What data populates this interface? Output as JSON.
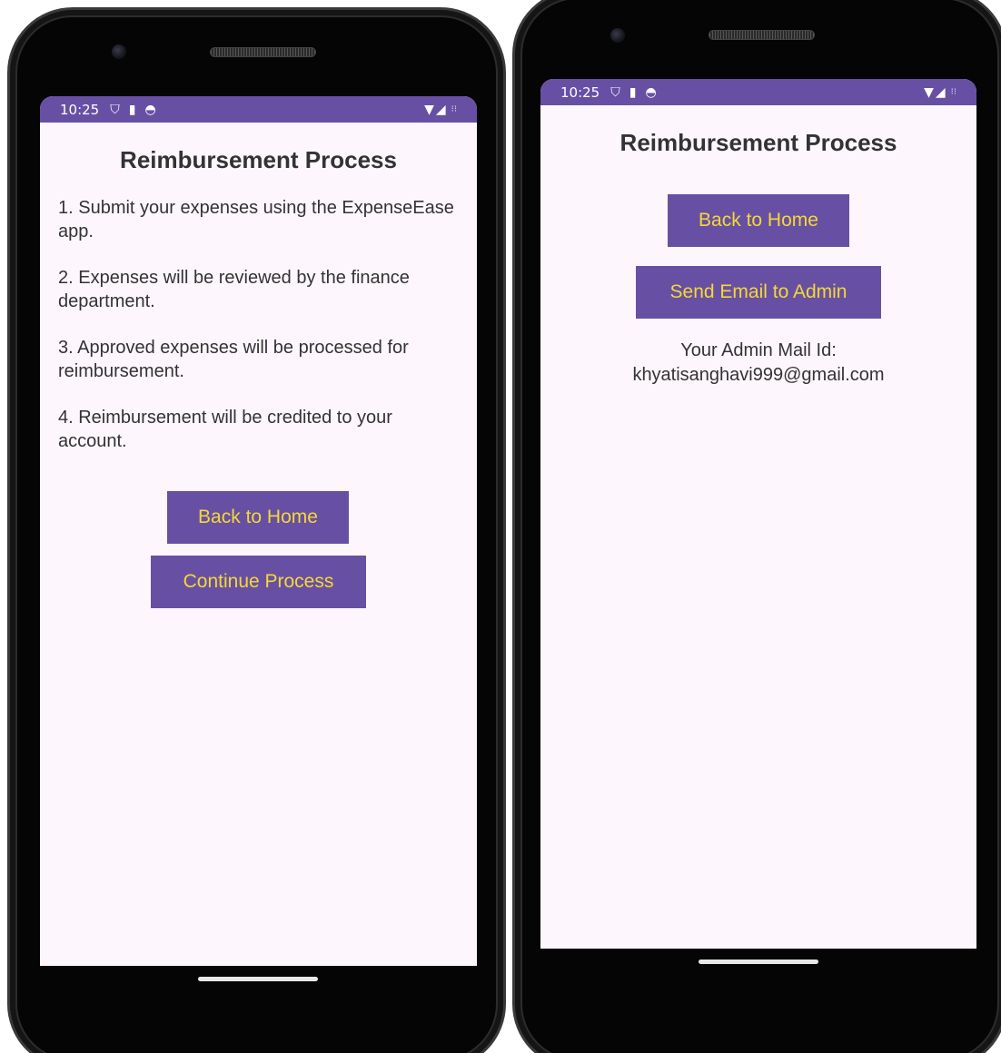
{
  "left_screen": {
    "status": {
      "time": "10:25"
    },
    "title": "Reimbursement Process",
    "steps": [
      "1. Submit your expenses using the ExpenseEase app.",
      "2. Expenses will be reviewed by the finance department.",
      "3. Approved expenses will be processed for reimbursement.",
      "4. Reimbursement will be credited to your account."
    ],
    "back_button": "Back to Home",
    "continue_button": "Continue Process"
  },
  "right_screen": {
    "status": {
      "time": "10:25"
    },
    "title": "Reimbursement Process",
    "back_button": "Back to Home",
    "email_button": "Send Email to Admin",
    "mail_label": "Your Admin Mail Id:",
    "mail_value": "khyatisanghavi999@gmail.com"
  },
  "icons": {
    "status_left": [
      "shield-icon",
      "sd-card-icon",
      "sync-icon"
    ],
    "status_right": [
      "wifi-icon",
      "signal-icon",
      "more-icon"
    ]
  },
  "colors": {
    "primary": "#6750a4",
    "button_text": "#f6d735",
    "screen_bg": "#fdf7fd",
    "text": "#333333"
  }
}
